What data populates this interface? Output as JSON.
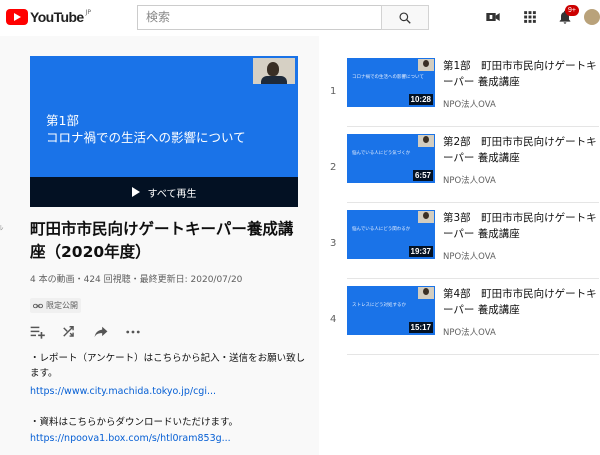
{
  "header": {
    "logo_text": "YouTube",
    "logo_region": "JP",
    "search_placeholder": "検索",
    "notification_count": "9+",
    "icons": [
      "video-camera-icon",
      "apps-grid-icon",
      "bell-icon",
      "search-icon"
    ],
    "brand_color": "#ff0000"
  },
  "playlist": {
    "hero": {
      "line1": "第1部",
      "line2": "コロナ禍での生活への影響について",
      "play_all_label": "すべて再生"
    },
    "title": "町田市市民向けゲートキーパー養成講座（2020年度）",
    "stats": "4 本の動画・424 回視聴・最終更新日: 2020/07/20",
    "privacy_label": "限定公開",
    "description": {
      "line1": "・レポート（アンケート）はこちらから記入・送信をお願い致します。",
      "link1": "https://www.city.machida.tokyo.jp/cgi...",
      "line2": "・資料はこちらからダウンロードいただけます。",
      "link2": "https://npoova1.box.com/s/htl0ram853g..."
    }
  },
  "items": [
    {
      "index": "1",
      "title": "第1部　町田市市民向けゲートキーパー 養成講座",
      "channel": "NPO法人OVA",
      "duration": "10:28",
      "thumb_caption": "コロナ禍での生活への影響について"
    },
    {
      "index": "2",
      "title": "第2部　町田市市民向けゲートキーパー 養成講座",
      "channel": "NPO法人OVA",
      "duration": "6:57",
      "thumb_caption": "悩んでいる人にどう気づくか"
    },
    {
      "index": "3",
      "title": "第3部　町田市市民向けゲートキーパー 養成講座",
      "channel": "NPO法人OVA",
      "duration": "19:37",
      "thumb_caption": "悩んでいる人にどう関わるか"
    },
    {
      "index": "4",
      "title": "第4部　町田市市民向けゲートキーパー 養成講座",
      "channel": "NPO法人OVA",
      "duration": "15:17",
      "thumb_caption": "ストレスにどう対処するか"
    }
  ]
}
